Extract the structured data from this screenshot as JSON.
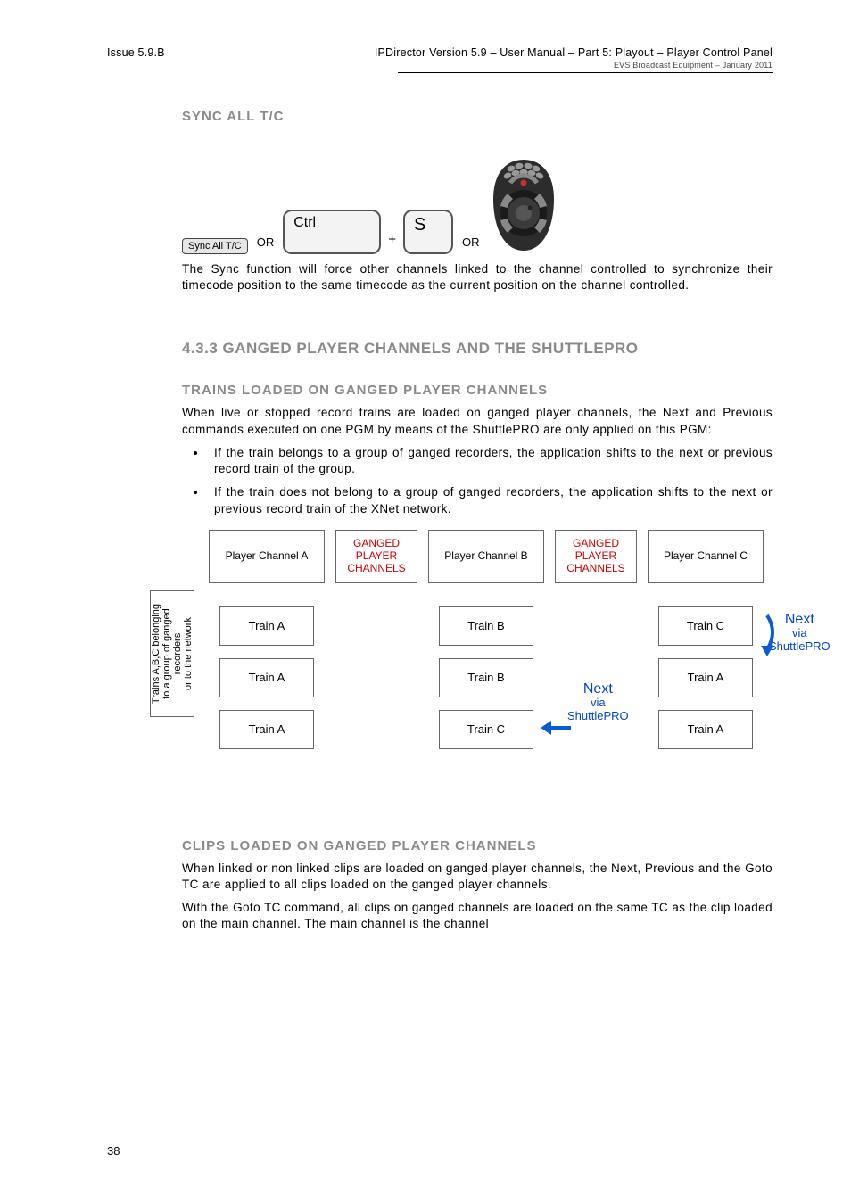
{
  "header": {
    "issue": "Issue 5.9.B",
    "title": "IPDirector Version 5.9 – User Manual – Part 5: Playout – Player Control Panel",
    "sub": "EVS Broadcast Equipment – January 2011"
  },
  "section": {
    "sync_label": "SYNC ALL T/C",
    "sync_row": {
      "button": "Sync All T/C",
      "or": "OR",
      "ctrl": "Ctrl",
      "plus": "+",
      "s": "S"
    },
    "sync_para": "The Sync function will force other channels linked to the channel controlled to synchronize their timecode position to the same timecode as the current position on the channel controlled.",
    "heading2": "4.3.3 GANGED PLAYER CHANNELS AND THE SHUTTLEPRO",
    "trains_title": "TRAINS LOADED ON GANGED PLAYER CHANNELS",
    "trains_para": "When live or stopped record trains are loaded on ganged player channels, the Next and Previous commands executed on one PGM by means of the ShuttlePRO are only applied on this PGM:",
    "bullet1": "If the train belongs to a group of ganged recorders, the application shifts to the next or previous record train of the group.",
    "bullet2": "If the train does not belong to a group of ganged recorders, the application shifts to the next or previous record train of the XNet network.",
    "diagram": {
      "side": "Trains A,B,C belonging\nto a group of ganged recorders\nor to the network",
      "pca": "Player Channel A",
      "pcb": "Player Channel B",
      "pcc": "Player Channel C",
      "gpc": "GANGED\nPLAYER\nCHANNELS",
      "ta": "Train A",
      "tb": "Train B",
      "tc": "Train C",
      "next": "Next",
      "via": "via\nShuttlePRO"
    },
    "clips_title": "CLIPS LOADED ON GANGED PLAYER CHANNELS",
    "clips_p1": "When linked or non linked clips are loaded on ganged player channels, the Next, Previous and the Goto TC are applied to all clips loaded on the ganged player channels.",
    "clips_p2": "With the Goto TC command, all clips on ganged channels are loaded on the same TC as the clip loaded on the main channel. The main channel is the channel"
  },
  "page_number": "38"
}
